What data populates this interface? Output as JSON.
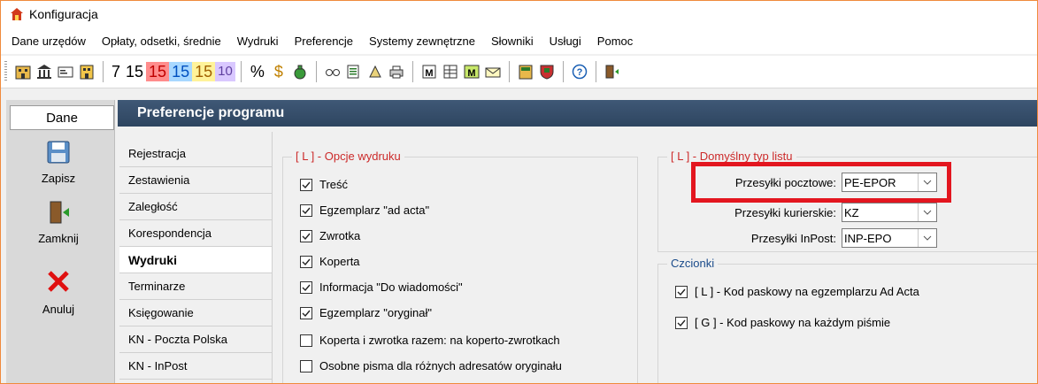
{
  "window": {
    "title": "Konfiguracja"
  },
  "menu": [
    "Dane urzędów",
    "Opłaty, odsetki, średnie",
    "Wydruki",
    "Preferencje",
    "Systemy zewnętrzne",
    "Słowniki",
    "Usługi",
    "Pomoc"
  ],
  "toolbar": {
    "numbers": [
      "7",
      "15",
      "15",
      "15",
      "15",
      "10"
    ],
    "percent": "%",
    "dollar": "$"
  },
  "left_panel": {
    "tab": "Dane",
    "save": "Zapisz",
    "close": "Zamknij",
    "cancel": "Anuluj"
  },
  "header": {
    "title": "Preferencje programu"
  },
  "nav": [
    "Rejestracja",
    "Zestawienia",
    "Zaległość",
    "Korespondencja",
    "Wydruki",
    "Terminarze",
    "Księgowanie",
    "KN - Poczta Polska",
    "KN - InPost"
  ],
  "nav_active_index": 4,
  "print_options": {
    "title": "[ L ] - Opcje wydruku",
    "items": [
      {
        "label": "Treść",
        "checked": true
      },
      {
        "label": "Egzemplarz \"ad acta\"",
        "checked": true
      },
      {
        "label": "Zwrotka",
        "checked": true
      },
      {
        "label": "Koperta",
        "checked": true
      },
      {
        "label": "Informacja \"Do wiadomości\"",
        "checked": true
      },
      {
        "label": "Egzemplarz \"oryginał\"",
        "checked": true
      },
      {
        "label": "Koperta i zwrotka razem: na koperto-zwrotkach",
        "checked": false
      },
      {
        "label": "Osobne pisma dla różnych adresatów oryginału",
        "checked": false
      }
    ]
  },
  "letter_type": {
    "title": "[ L ] - Domyślny typ listu",
    "rows": [
      {
        "label": "Przesyłki pocztowe:",
        "value": "PE-EPOR"
      },
      {
        "label": "Przesyłki kurierskie:",
        "value": "KZ"
      },
      {
        "label": "Przesyłki InPost:",
        "value": "INP-EPO"
      }
    ]
  },
  "fonts": {
    "title": "Czcionki",
    "items": [
      {
        "label": "[ L ] - Kod paskowy na egzemplarzu Ad Acta",
        "checked": true
      },
      {
        "label": "[ G ] - Kod paskowy na każdym piśmie",
        "checked": true
      }
    ]
  },
  "colors": {
    "accent": "#e3161f",
    "header_bg": "#3f5876",
    "group_label": "#cc2a2a"
  }
}
